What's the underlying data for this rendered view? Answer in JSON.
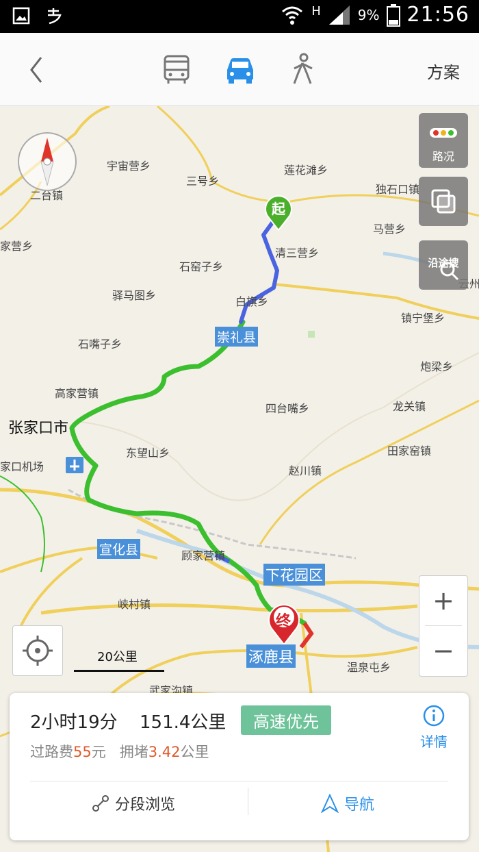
{
  "status_bar": {
    "network": "H",
    "battery": "9%",
    "time": "21:56"
  },
  "header": {
    "modes": [
      "bus-icon",
      "car-icon",
      "walk-icon"
    ],
    "active_mode": "car",
    "plan_label": "方案"
  },
  "map": {
    "controls": {
      "traffic": "路况",
      "layers": "",
      "along_search": "沿途搜"
    },
    "scale_label": "20公里",
    "start_marker": "起",
    "end_marker": "终",
    "places": [
      "宇宙营乡",
      "三号乡",
      "莲花滩乡",
      "独石口镇",
      "二台镇",
      "家营乡",
      "清三营乡",
      "马营乡",
      "石窑子乡",
      "驿马图乡",
      "白旗乡",
      "云州",
      "镇宁堡乡",
      "石嘴子乡",
      "炮梁乡",
      "高家营镇",
      "四台嘴乡",
      "龙关镇",
      "东望山乡",
      "田家窑镇",
      "家口机场",
      "赵川镇",
      "顾家营镇",
      "峡村镇",
      "温泉屯乡",
      "武家沟镇"
    ],
    "counties": [
      "崇礼县",
      "宣化县",
      "下花园区",
      "涿鹿县"
    ],
    "city": "张家口市"
  },
  "route_card": {
    "duration": "2小时19分",
    "distance": "151.4公里",
    "preference": "高速优先",
    "toll_prefix": "过路费",
    "toll_value": "55",
    "toll_unit": "元",
    "jam_prefix": "拥堵",
    "jam_value": "3.42",
    "jam_unit": "公里",
    "details_label": "详情",
    "segment_label": "分段浏览",
    "navigate_label": "导航"
  },
  "colors": {
    "accent": "#2a8fe8",
    "route_green": "#3cbf2e",
    "route_blue": "#4a63e0",
    "tag": "#6ec39a"
  }
}
